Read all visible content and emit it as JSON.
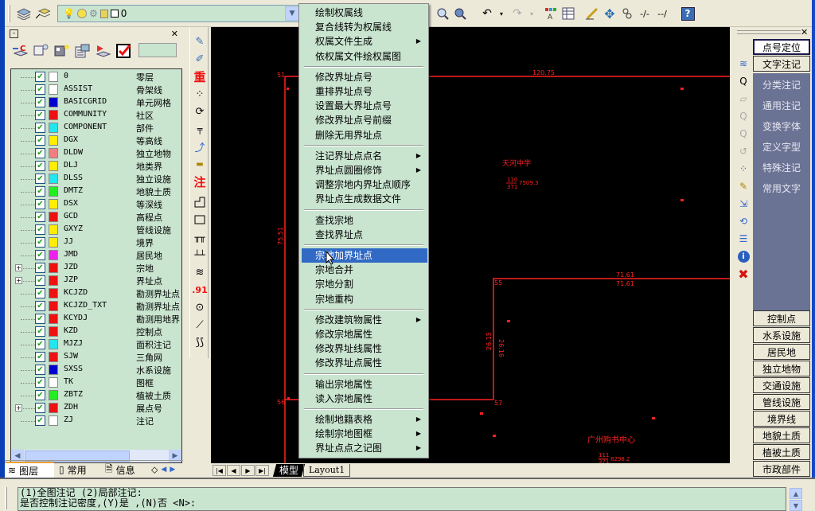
{
  "toolbar": {
    "layer_combo_value": "0",
    "icons": [
      "layers-icon",
      "layer-previous-icon",
      "bulb-icon",
      "sun-icon",
      "freeze-icon",
      "lock-icon",
      "color-swatch-icon",
      "zoom-realtime-icon",
      "zoom-window-icon",
      "pan-icon",
      "undo-icon",
      "redo-icon",
      "properties-icon",
      "table-icon",
      "match-properties-icon",
      "move-icon",
      "copy-icon",
      "trim-icon",
      "extend-icon",
      "help-icon"
    ]
  },
  "left_panel": {
    "layers": [
      {
        "name": "0",
        "cn": "零层",
        "color": "#ffffff",
        "expand": false
      },
      {
        "name": "ASSIST",
        "cn": "骨架线",
        "color": "#ffffff",
        "expand": false
      },
      {
        "name": "BASICGRID",
        "cn": "单元网格",
        "color": "#0000cc",
        "expand": false
      },
      {
        "name": "COMMUNITY",
        "cn": "社区",
        "color": "#ee1111",
        "expand": false
      },
      {
        "name": "COMPONENT",
        "cn": "部件",
        "color": "#22e6f0",
        "expand": false
      },
      {
        "name": "DGX",
        "cn": "等高线",
        "color": "#ffee00",
        "expand": false
      },
      {
        "name": "DLDW",
        "cn": "独立地物",
        "color": "#f08080",
        "expand": false
      },
      {
        "name": "DLJ",
        "cn": "地类界",
        "color": "#ffee00",
        "expand": false
      },
      {
        "name": "DLSS",
        "cn": "独立设施",
        "color": "#22e6f0",
        "expand": false
      },
      {
        "name": "DMTZ",
        "cn": "地貌土质",
        "color": "#22ee22",
        "expand": false
      },
      {
        "name": "DSX",
        "cn": "等深线",
        "color": "#ffee00",
        "expand": false
      },
      {
        "name": "GCD",
        "cn": "高程点",
        "color": "#ee1111",
        "expand": false
      },
      {
        "name": "GXYZ",
        "cn": "管线设施",
        "color": "#ffee00",
        "expand": false
      },
      {
        "name": "JJ",
        "cn": "境界",
        "color": "#ffee00",
        "expand": false
      },
      {
        "name": "JMD",
        "cn": "居民地",
        "color": "#ee22ee",
        "expand": false
      },
      {
        "name": "JZD",
        "cn": "宗地",
        "color": "#ee1111",
        "expand": true
      },
      {
        "name": "JZP",
        "cn": "界址点",
        "color": "#ee1111",
        "expand": true
      },
      {
        "name": "KCJZD",
        "cn": "勘测界址点",
        "color": "#ee1111",
        "expand": false
      },
      {
        "name": "KCJZD_TXT",
        "cn": "勘测界址点",
        "color": "#ee1111",
        "expand": false
      },
      {
        "name": "KCYDJ",
        "cn": "勘测用地界",
        "color": "#ee1111",
        "expand": false
      },
      {
        "name": "KZD",
        "cn": "控制点",
        "color": "#ee1111",
        "expand": false
      },
      {
        "name": "MJZJ",
        "cn": "面积注记",
        "color": "#22e6f0",
        "expand": false
      },
      {
        "name": "SJW",
        "cn": "三角网",
        "color": "#ee1111",
        "expand": false
      },
      {
        "name": "SXSS",
        "cn": "水系设施",
        "color": "#0000cc",
        "expand": false
      },
      {
        "name": "TK",
        "cn": "图框",
        "color": "#ffffff",
        "expand": false
      },
      {
        "name": "ZBTZ",
        "cn": "植被土质",
        "color": "#22ee22",
        "expand": false
      },
      {
        "name": "ZDH",
        "cn": "展点号",
        "color": "#ee1111",
        "expand": true
      },
      {
        "name": "ZJ",
        "cn": "注记",
        "color": "#ffffff",
        "expand": false
      }
    ],
    "tabs": [
      {
        "label": "图层",
        "icon": "layers-icon"
      },
      {
        "label": "常用",
        "icon": "list-icon"
      },
      {
        "label": "信息",
        "icon": "info-doc-icon"
      }
    ]
  },
  "menu": {
    "items": [
      {
        "label": "绘制权属线",
        "sub": false
      },
      {
        "label": "复合线转为权属线",
        "sub": false
      },
      {
        "label": "权属文件生成",
        "sub": true
      },
      {
        "label": "依权属文件绘权属图",
        "sub": false
      },
      {
        "sep": true
      },
      {
        "label": "修改界址点号",
        "sub": false
      },
      {
        "label": "重排界址点号",
        "sub": false
      },
      {
        "label": "设置最大界址点号",
        "sub": false
      },
      {
        "label": "修改界址点号前缀",
        "sub": false
      },
      {
        "label": "删除无用界址点",
        "sub": false
      },
      {
        "sep": true
      },
      {
        "label": "注记界址点点名",
        "sub": true
      },
      {
        "label": "界址点圆圈修饰",
        "sub": true
      },
      {
        "label": "调整宗地内界址点顺序",
        "sub": false
      },
      {
        "label": "界址点生成数据文件",
        "sub": false
      },
      {
        "sep": true
      },
      {
        "label": "查找宗地",
        "sub": false
      },
      {
        "label": "查找界址点",
        "sub": false
      },
      {
        "sep": true
      },
      {
        "label": "宗地加界址点",
        "sub": false,
        "selected": true
      },
      {
        "label": "宗地合并",
        "sub": false
      },
      {
        "label": "宗地分割",
        "sub": false
      },
      {
        "label": "宗地重构",
        "sub": false
      },
      {
        "sep": true
      },
      {
        "label": "修改建筑物属性",
        "sub": true
      },
      {
        "label": "修改宗地属性",
        "sub": false
      },
      {
        "label": "修改界址线属性",
        "sub": false
      },
      {
        "label": "修改界址点属性",
        "sub": false
      },
      {
        "sep": true
      },
      {
        "label": "输出宗地属性",
        "sub": false
      },
      {
        "label": "读入宗地属性",
        "sub": false
      },
      {
        "sep": true
      },
      {
        "label": "绘制地籍表格",
        "sub": true
      },
      {
        "label": "绘制宗地图框",
        "sub": true
      },
      {
        "label": "界址点点之记图",
        "sub": true
      }
    ]
  },
  "canvas": {
    "labels": {
      "p51": "51",
      "p56": "56",
      "p55": "55",
      "p57": "57",
      "dim_top": "120.75",
      "dim_left": "75.51",
      "dim_mid1": "71.61",
      "dim_mid2": "71.61",
      "dim_v1": "26.15",
      "dim_v2": "26.16",
      "parcel1_name": "天河中学",
      "parcel1_num": "110",
      "parcel1_den": "371",
      "parcel1_area": "7509.3",
      "parcel2_name": "广州购书中心",
      "parcel2_num": "111",
      "parcel2_den": "371",
      "parcel2_area": "8298.2"
    },
    "sheet_tabs": [
      "模型",
      "Layout1"
    ],
    "line_color": "#ff2020"
  },
  "right_panel": {
    "top_buttons": [
      "点号定位",
      "文字注记"
    ],
    "text_items": [
      "分类注记",
      "通用注记",
      "变换字体",
      "定义字型",
      "特殊注记",
      "常用文字"
    ],
    "bottom_buttons": [
      "控制点",
      "水系设施",
      "居民地",
      "独立地物",
      "交通设施",
      "管线设施",
      "境界线",
      "地貌土质",
      "植被土质",
      "市政部件"
    ]
  },
  "command_line": {
    "line1": "(1)全图注记 (2)局部注记:",
    "line2": "是否控制注记密度,(Y)是 ,(N)否 <N>:"
  }
}
